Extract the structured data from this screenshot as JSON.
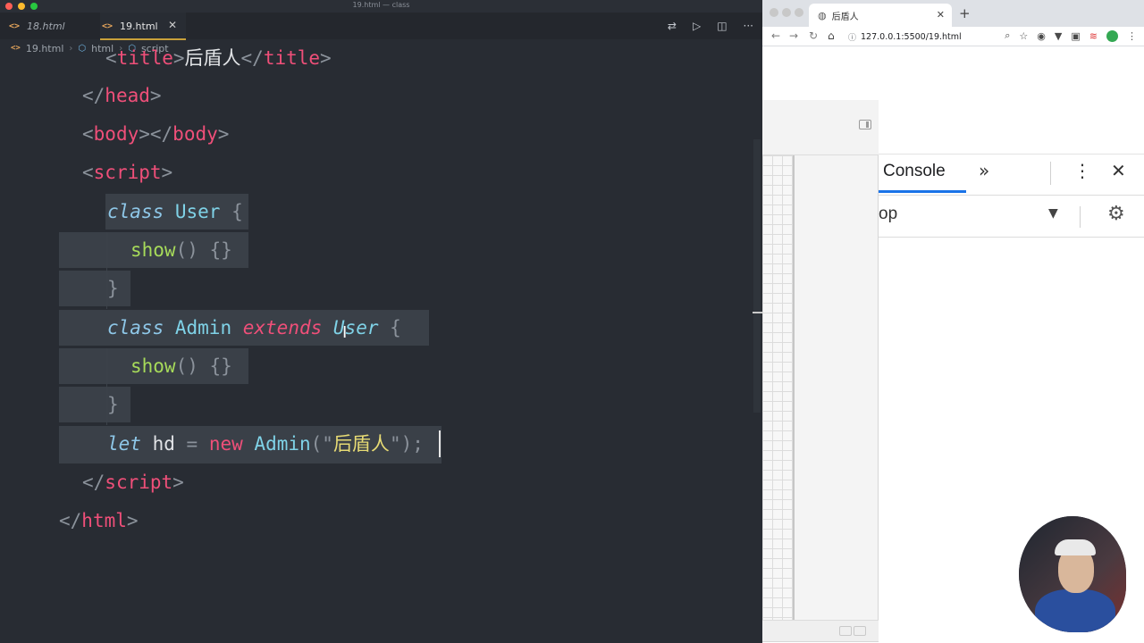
{
  "window": {
    "title": "19.html — class"
  },
  "editor": {
    "tabs": [
      {
        "label": "18.html",
        "active": false
      },
      {
        "label": "19.html",
        "active": true
      }
    ],
    "breadcrumb": [
      "19.html",
      "html",
      "script"
    ],
    "code": {
      "l1_text": "后盾人",
      "l2_tag": "head",
      "l3_tag": "body",
      "l4_tag": "script",
      "kw_class": "class",
      "name_user": "User",
      "name_admin": "Admin",
      "method": "show",
      "kw_extends": "extends",
      "kw_let": "let",
      "var_name": "hd",
      "kw_new": "new",
      "string_value": "后盾人",
      "close_script": "script",
      "close_html": "html"
    }
  },
  "browser": {
    "tab_title": "后盾人",
    "url": "127.0.0.1:5500/19.html",
    "devtools": {
      "active_tab": "Console",
      "context": "op",
      "accent_color": "#1a73e8"
    }
  }
}
